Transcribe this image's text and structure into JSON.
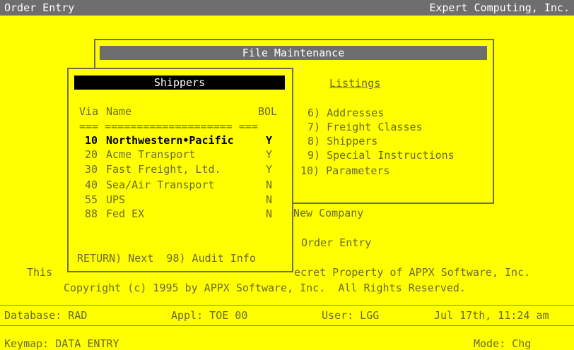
{
  "header": {
    "app": "Order Entry",
    "company": "Expert Computing, Inc."
  },
  "file_maintenance": {
    "title": "File Maintenance",
    "listings_heading": "Listings",
    "menu": [
      "6) Addresses",
      "7) Freight Classes",
      "8) Shippers",
      "9) Special Instructions",
      "10) Parameters"
    ]
  },
  "background": {
    "new_company": "New Company",
    "order_entry": "Order Entry",
    "trade_secret_left": "This",
    "trade_secret_right": "ecret Property of APPX Software, Inc.",
    "copyright": "Copyright (c) 1995 by APPX Software, Inc.  All Rights Reserved."
  },
  "shippers": {
    "title": "Shippers",
    "columns": {
      "via": "Via",
      "name": "Name",
      "bol": "BOL"
    },
    "rule": "=== ==================== ===",
    "rows": [
      {
        "via": "10",
        "name": "Northwestern•Pacific",
        "bol": "Y",
        "selected": true
      },
      {
        "via": "20",
        "name": "Acme Transport",
        "bol": "Y"
      },
      {
        "via": "30",
        "name": "Fast Freight, Ltd.",
        "bol": "Y"
      },
      {
        "via": "40",
        "name": "Sea/Air Transport",
        "bol": "N"
      },
      {
        "via": "55",
        "name": "UPS",
        "bol": "N"
      },
      {
        "via": "88",
        "name": "Fed EX",
        "bol": "N"
      }
    ],
    "footer": "RETURN) Next  98) Audit Info"
  },
  "status": {
    "database": "Database: RAD",
    "appl": "Appl: TOE 00",
    "user": "User: LGG",
    "datetime": "Jul 17th, 11:24 am",
    "keymap": "Keymap: DATA ENTRY",
    "mode": "Mode: Chg"
  },
  "colors": {
    "background": "#ffff00",
    "text": "#6a6a28",
    "titlebar": "#6e6e6e",
    "selected_text": "#000000"
  }
}
